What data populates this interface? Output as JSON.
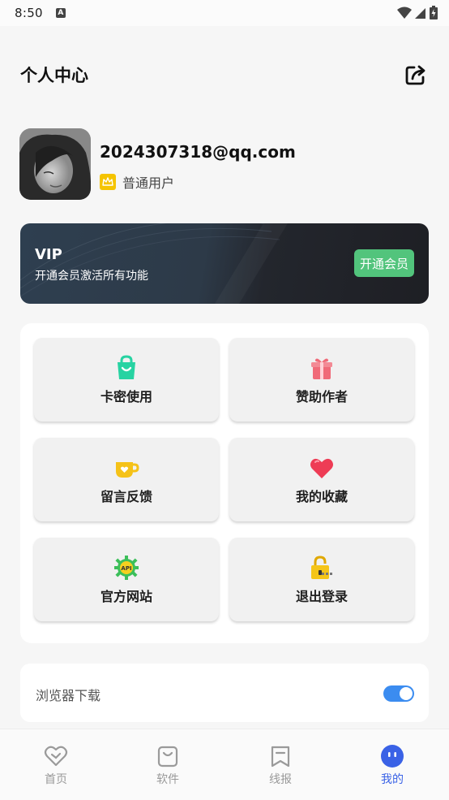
{
  "status_bar": {
    "time": "8:50",
    "notif_icon": "a-icon"
  },
  "header": {
    "title": "个人中心",
    "share_icon": "share-icon"
  },
  "profile": {
    "email": "2024307318@qq.com",
    "level": "普通用户"
  },
  "vip": {
    "title": "VIP",
    "description": "开通会员激活所有功能",
    "button": "开通会员"
  },
  "grid": [
    {
      "label": "卡密使用",
      "icon": "shopping-bag-icon"
    },
    {
      "label": "赞助作者",
      "icon": "gift-icon"
    },
    {
      "label": "留言反馈",
      "icon": "coffee-cup-icon"
    },
    {
      "label": "我的收藏",
      "icon": "heart-icon"
    },
    {
      "label": "官方网站",
      "icon": "api-gear-icon"
    },
    {
      "label": "退出登录",
      "icon": "lock-icon"
    }
  ],
  "settings": {
    "browser_download": {
      "label": "浏览器下载",
      "enabled": true
    }
  },
  "tabs": [
    {
      "label": "首页",
      "icon": "heart-outline-icon",
      "active": false
    },
    {
      "label": "软件",
      "icon": "bag-outline-icon",
      "active": false
    },
    {
      "label": "线报",
      "icon": "bookmark-outline-icon",
      "active": false
    },
    {
      "label": "我的",
      "icon": "face-icon",
      "active": true
    }
  ],
  "colors": {
    "accent": "#3a62e6",
    "vip_button": "#52c47c",
    "toggle_on": "#3b8cf0",
    "crown": "#f5c400"
  }
}
